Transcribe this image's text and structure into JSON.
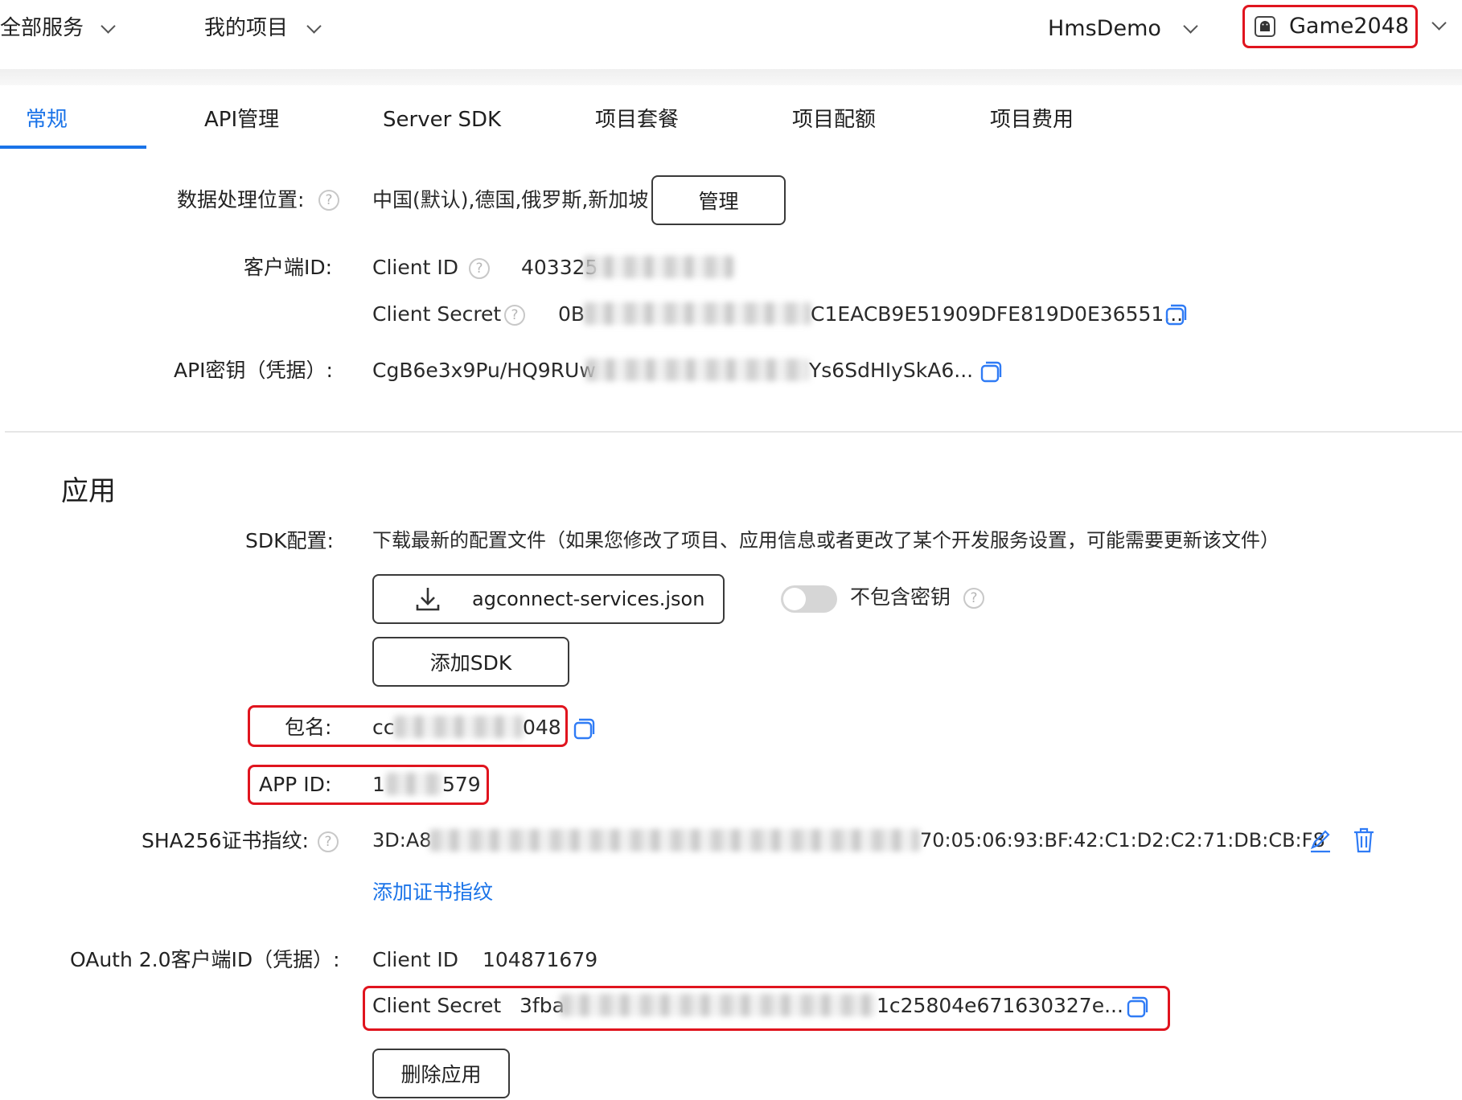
{
  "topbar": {
    "all_services": "全部服务",
    "my_projects": "我的项目",
    "project_name": "HmsDemo",
    "app_name": "Game2048"
  },
  "tabs": [
    {
      "label": "常规",
      "active": true
    },
    {
      "label": "API管理"
    },
    {
      "label": "Server SDK"
    },
    {
      "label": "项目套餐"
    },
    {
      "label": "项目配额"
    },
    {
      "label": "项目费用"
    }
  ],
  "project": {
    "data_location_label": "数据处理位置:",
    "data_location_value": "中国(默认),德国,俄罗斯,新加坡",
    "manage_button": "管理",
    "client_label": "客户端ID:",
    "client_id_label": "Client ID",
    "client_id_value": "403325",
    "client_secret_label": "Client Secret",
    "client_secret_prefix": "0B",
    "client_secret_suffix": "C1EACB9E51909DFE819D0E36551...",
    "api_key_label": "API密钥（凭据）:",
    "api_key_prefix": "CgB6e3x9Pu/HQ9RUw",
    "api_key_suffix": "Ys6SdHIySkA6..."
  },
  "app": {
    "section_title": "应用",
    "sdk_label": "SDK配置:",
    "sdk_desc": "下载最新的配置文件（如果您修改了项目、应用信息或者更改了某个开发服务设置，可能需要更新该文件）",
    "download_button": "agconnect-services.json",
    "exclude_key_label": "不包含密钥",
    "exclude_key_on": false,
    "add_sdk_button": "添加SDK",
    "package_label": "包名:",
    "package_prefix": "cc",
    "package_suffix": "048",
    "appid_label": "APP ID:",
    "appid_prefix": "1",
    "appid_suffix": "579",
    "sha_label": "SHA256证书指纹:",
    "sha_prefix": "3D:A8",
    "sha_suffix": "70:05:06:93:BF:42:C1:D2:C2:71:DB:CB:F8",
    "add_cert_link": "添加证书指纹",
    "oauth_label": "OAuth 2.0客户端ID（凭据）:",
    "oauth_client_id_label": "Client ID",
    "oauth_client_id_value": "104871679",
    "oauth_secret_label": "Client Secret",
    "oauth_secret_prefix": "3fba",
    "oauth_secret_suffix": "1c25804e671630327e...",
    "delete_button": "删除应用"
  },
  "colors": {
    "accent": "#1a73e8",
    "highlight": "#e0141e",
    "copy_icon": "#2f7bf5"
  },
  "icons": [
    "chevron-down-icon",
    "android-icon",
    "help-icon",
    "copy-icon",
    "download-icon",
    "edit-icon",
    "delete-icon"
  ]
}
